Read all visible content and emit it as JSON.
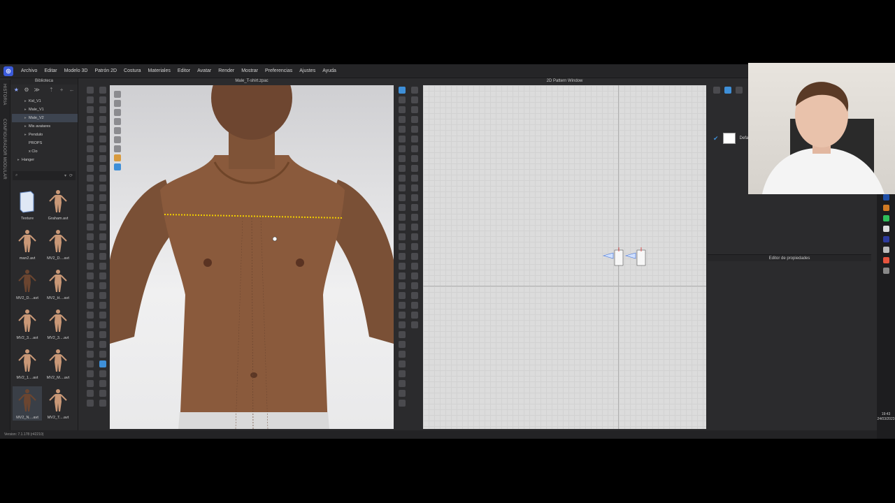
{
  "menu": {
    "items": [
      "Archivo",
      "Editar",
      "Modelo 3D",
      "Patrón 2D",
      "Costura",
      "Materiales",
      "Editor",
      "Avatar",
      "Render",
      "Mostrar",
      "Preferencias",
      "Ajustes",
      "Ayuda"
    ]
  },
  "sidebar": {
    "history_label": "HISTORIA",
    "config_label": "CONFIGURADOR MODULAR"
  },
  "library": {
    "title": "Biblioteca",
    "tree": [
      {
        "label": "Kid_V1",
        "arrow": "▸",
        "selected": false
      },
      {
        "label": "Male_V1",
        "arrow": "▸",
        "selected": false
      },
      {
        "label": "Male_V2",
        "arrow": "▸",
        "selected": true
      },
      {
        "label": "Mis avatares",
        "arrow": "▸",
        "selected": false
      },
      {
        "label": "Pendulo",
        "arrow": "▸",
        "selected": false
      },
      {
        "label": "PROPS",
        "arrow": "",
        "selected": false
      },
      {
        "label": "x Clo",
        "arrow": "",
        "selected": false
      },
      {
        "label": "Hanger",
        "arrow": "▸",
        "selected": false
      }
    ],
    "items": [
      {
        "label": "Texture",
        "kind": "folder",
        "selected": false
      },
      {
        "label": "Graham.avt",
        "kind": "avatar",
        "selected": false
      },
      {
        "label": "man2.avt",
        "kind": "avatar",
        "selected": false
      },
      {
        "label": "MV2_D....avt",
        "kind": "avatar",
        "selected": false
      },
      {
        "label": "MV2_D....avt",
        "kind": "avatar-dark",
        "selected": false
      },
      {
        "label": "MV2_H....avt",
        "kind": "avatar",
        "selected": false
      },
      {
        "label": "MV2_3....avt",
        "kind": "avatar",
        "selected": false
      },
      {
        "label": "MV2_3....avt",
        "kind": "avatar",
        "selected": false
      },
      {
        "label": "MV2_1....avt",
        "kind": "avatar",
        "selected": false
      },
      {
        "label": "MV2_M....avt",
        "kind": "avatar",
        "selected": false
      },
      {
        "label": "MV2_N....avt",
        "kind": "avatar-dark",
        "selected": true
      },
      {
        "label": "MV2_T....avt",
        "kind": "avatar",
        "selected": false
      }
    ]
  },
  "viewport3d": {
    "title": "Male_T-shirt.zpac"
  },
  "pattern_window": {
    "title": "2D Pattern Window"
  },
  "right_panel": {
    "fabric_name": "Defa",
    "properties_title": "Editor de propiedades"
  },
  "taskbar": {
    "time": "19:43",
    "date": "24/03/2023"
  },
  "status": {
    "version": "Version: 7.1.178 (r42210)"
  },
  "colors": {
    "accent": "#3e8fd8",
    "panel_bg": "#2b2b2d",
    "seam_line": "#f2d000"
  }
}
